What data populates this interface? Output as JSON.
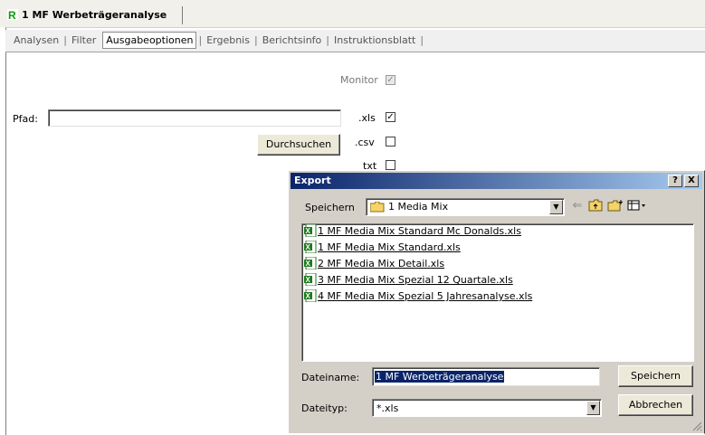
{
  "window": {
    "title": "1 MF Werbeträgeranalyse"
  },
  "tabs": [
    {
      "label": "Analysen",
      "active": false
    },
    {
      "label": "Filter",
      "active": false
    },
    {
      "label": "Ausgabeoptionen",
      "active": true
    },
    {
      "label": "Ergebnis",
      "active": false
    },
    {
      "label": "Berichtsinfo",
      "active": false
    },
    {
      "label": "Instruktionsblatt",
      "active": false
    }
  ],
  "options": {
    "monitor_label": "Monitor",
    "monitor_checked": true,
    "pfad_label": "Pfad:",
    "pfad_value": "",
    "browse_label": "Durchsuchen",
    "xls_label": ".xls",
    "xls_checked": true,
    "csv_label": ".csv",
    "csv_checked": false,
    "txt_label": "txt",
    "txt_checked": false
  },
  "dialog": {
    "title": "Export",
    "help_label": "?",
    "close_label": "X",
    "save_in_label": "Speichern",
    "save_in_value": "1 Media Mix",
    "files": [
      "1 MF Media Mix Standard Mc Donalds.xls",
      "1 MF Media Mix Standard.xls",
      "2 MF Media Mix Detail.xls",
      "3 MF Media Mix Spezial 12 Quartale.xls",
      "4 MF Media Mix Spezial 5 Jahresanalyse.xls"
    ],
    "filename_label": "Dateiname:",
    "filename_value": "1 MF Werbeträgeranalyse",
    "filetype_label": "Dateityp:",
    "filetype_value": "*.xls",
    "save_button": "Speichern",
    "cancel_button": "Abbrechen"
  },
  "colors": {
    "title_bar_start": "#0a246a",
    "title_bar_end": "#a6caf0",
    "dialog_bg": "#d4d0c8",
    "selection": "#0a246a"
  }
}
